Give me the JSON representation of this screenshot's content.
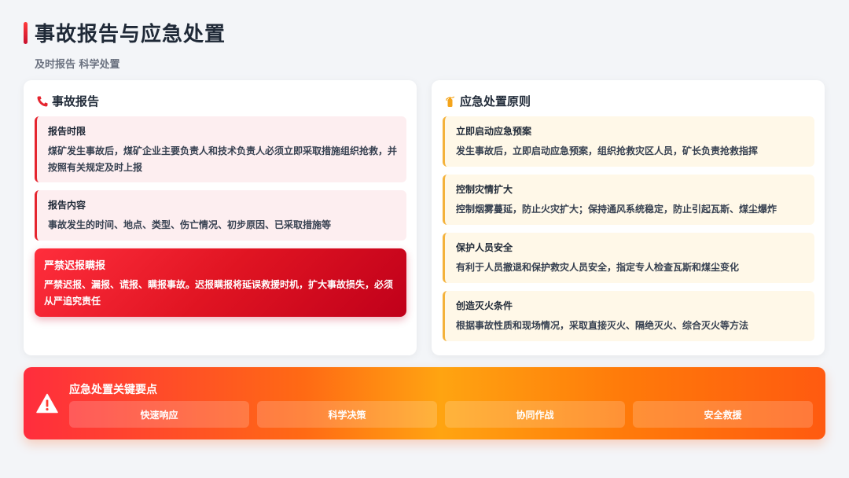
{
  "header": {
    "title": "事故报告与应急处置",
    "subtitle": "及时报告 科学处置"
  },
  "left_card": {
    "title": "事故报告",
    "icon": "phone-icon",
    "items": [
      {
        "title": "报告时限",
        "text": "煤矿发生事故后，煤矿企业主要负责人和技术负责人必须立即采取措施组织抢救，并按照有关规定及时上报"
      },
      {
        "title": "报告内容",
        "text": "事故发生的时间、地点、类型、伤亡情况、初步原因、已采取措施等"
      }
    ],
    "alert": {
      "title": "严禁迟报瞒报",
      "text": "严禁迟报、漏报、谎报、瞒报事故。迟报瞒报将延误救援时机，扩大事故损失，必须从严追究责任"
    }
  },
  "right_card": {
    "title": "应急处置原则",
    "icon": "fire-extinguisher-icon",
    "items": [
      {
        "title": "立即启动应急预案",
        "text": "发生事故后，立即启动应急预案，组织抢救灾区人员，矿长负责抢救指挥"
      },
      {
        "title": "控制灾情扩大",
        "text": "控制烟雾蔓延，防止火灾扩大；保持通风系统稳定，防止引起瓦斯、煤尘爆炸"
      },
      {
        "title": "保护人员安全",
        "text": "有利于人员撤退和保护救灾人员安全，指定专人检查瓦斯和煤尘变化"
      },
      {
        "title": "创造灭火条件",
        "text": "根据事故性质和现场情况，采取直接灭火、隔绝灭火、综合灭火等方法"
      }
    ]
  },
  "banner": {
    "icon": "warning-icon",
    "title": "应急处置关键要点",
    "points": [
      "快速响应",
      "科学决策",
      "协同作战",
      "安全救援"
    ]
  },
  "colors": {
    "accent_red": "#e5252f",
    "accent_yellow": "#f4b23b",
    "banner_orange": "#ff7a0a"
  }
}
